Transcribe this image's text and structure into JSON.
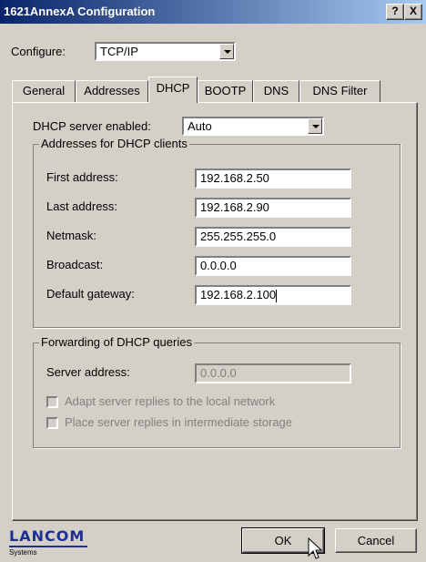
{
  "window": {
    "title": "1621AnnexA Configuration",
    "help_label": "?",
    "close_label": "X"
  },
  "configure": {
    "label": "Configure:",
    "value": "TCP/IP"
  },
  "tabs": [
    {
      "label": "General"
    },
    {
      "label": "Addresses"
    },
    {
      "label": "DHCP"
    },
    {
      "label": "BOOTP"
    },
    {
      "label": "DNS"
    },
    {
      "label": "DNS Filter"
    }
  ],
  "dhcp": {
    "server_enabled_label": "DHCP server enabled:",
    "server_enabled_value": "Auto",
    "clients_group_title": "Addresses for DHCP clients",
    "fields": [
      {
        "label": "First address:",
        "value": "192.168.2.50"
      },
      {
        "label": "Last address:",
        "value": "192.168.2.90"
      },
      {
        "label": "Netmask:",
        "value": "255.255.255.0"
      },
      {
        "label": "Broadcast:",
        "value": "0.0.0.0"
      },
      {
        "label": "Default gateway:",
        "value": "192.168.2.100"
      }
    ],
    "forwarding_group_title": "Forwarding of DHCP queries",
    "server_address_label": "Server address:",
    "server_address_value": "0.0.0.0",
    "adapt_label": "Adapt server replies to the local network",
    "place_label": "Place server replies in intermediate storage"
  },
  "footer": {
    "logo": "LANCOM",
    "logo_sub": "Systems",
    "ok_label": "OK",
    "cancel_label": "Cancel"
  },
  "colors": {
    "title_start": "#0a246a",
    "title_end": "#a6caf0",
    "face": "#d4d0c8",
    "logo_blue": "#1f2f8f"
  }
}
